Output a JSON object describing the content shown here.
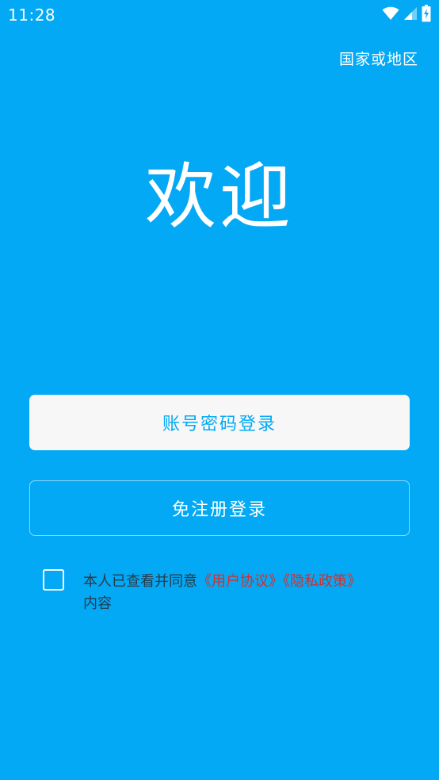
{
  "status_bar": {
    "time": "11:28",
    "icons": [
      "wifi-icon",
      "signal-icon",
      "battery-charging-icon"
    ]
  },
  "header": {
    "region_label": "国家或地区"
  },
  "main": {
    "welcome_text": "欢迎",
    "password_login_label": "账号密码登录",
    "quick_login_label": "免注册登录"
  },
  "agreement": {
    "checked": false,
    "prefix": "本人已查看并同意",
    "user_agreement": "《用户协议》",
    "privacy_policy": "《隐私政策》",
    "suffix": "内容"
  },
  "colors": {
    "background": "#03A9F4",
    "primary_button_bg": "#F7F7F7",
    "link": "#D32F2F"
  }
}
